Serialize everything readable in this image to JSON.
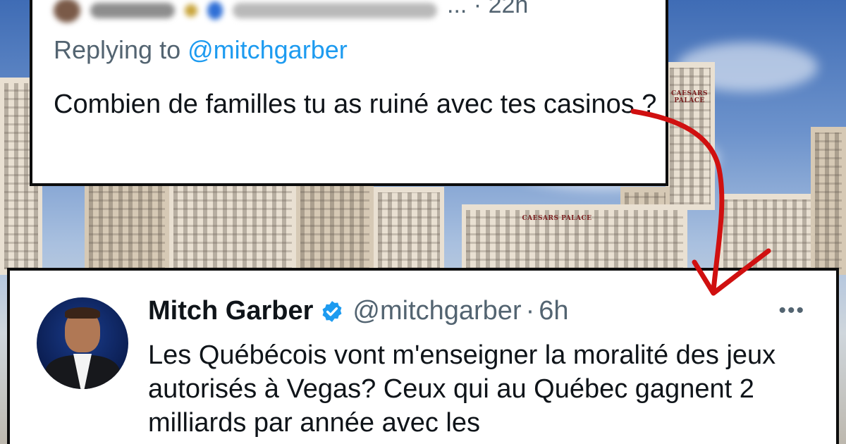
{
  "reply_tweet": {
    "timestamp_fragment": "...",
    "timestamp_suffix": "· 22h",
    "replying_prefix": "Replying to ",
    "replying_mention": "@mitchgarber",
    "text": "Combien de familles tu as ruiné avec tes casinos ?"
  },
  "main_tweet": {
    "display_name": "Mitch Garber",
    "handle": "@mitchgarber",
    "separator": "·",
    "age": "6h",
    "more_icon": "more-horizontal-icon",
    "text": "Les Québécois vont m'enseigner la moralité des jeux autorisés à Vegas? Ceux qui au Québec gagnent 2 milliards par année avec les"
  },
  "background": {
    "sign_top": "CAESARS PALACE",
    "sign_center": "CAESARS PALACE"
  },
  "colors": {
    "link": "#1d9bf0",
    "secondary_text": "#536471",
    "verified": "#1d9bf0",
    "arrow": "#d01010"
  }
}
